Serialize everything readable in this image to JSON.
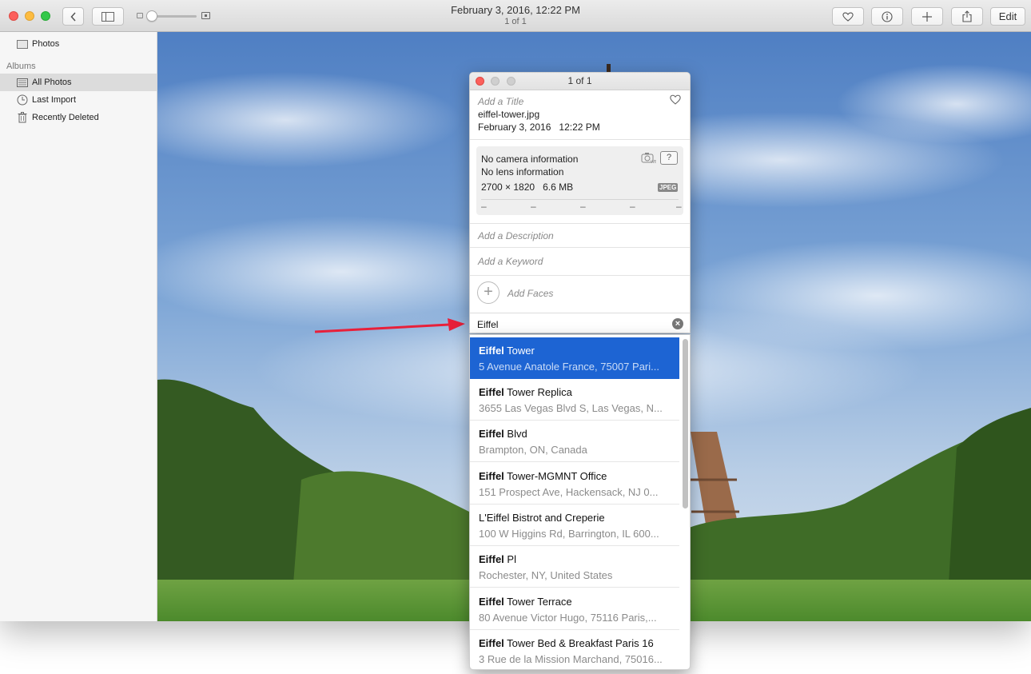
{
  "window": {
    "title": "February 3, 2016, 12:22 PM",
    "subtitle": "1 of 1"
  },
  "toolbar": {
    "back_icon": "chevron-left-icon",
    "sidebar_icon": "sidebar-icon",
    "favorite_icon": "heart-icon",
    "info_icon": "info-icon",
    "add_icon": "plus-icon",
    "share_icon": "share-icon",
    "edit_label": "Edit"
  },
  "sidebar": {
    "top_item": "Photos",
    "albums_header": "Albums",
    "items": [
      {
        "label": "All Photos",
        "icon": "photos-icon",
        "selected": true
      },
      {
        "label": "Last Import",
        "icon": "clock-icon",
        "selected": false
      },
      {
        "label": "Recently Deleted",
        "icon": "trash-icon",
        "selected": false
      }
    ]
  },
  "info_panel": {
    "title": "1 of 1",
    "title_placeholder": "Add a Title",
    "filename": "eiffel-tower.jpg",
    "date": "February 3, 2016",
    "time": "12:22 PM",
    "camera": "No camera information",
    "lens": "No lens information",
    "dimensions": "2700 × 1820",
    "size": "6.6 MB",
    "format": "JPEG",
    "exif_values": [
      "–",
      "–",
      "–",
      "–",
      "–"
    ],
    "description_placeholder": "Add a Description",
    "keyword_placeholder": "Add a Keyword",
    "faces_label": "Add Faces",
    "location_value": "Eiffel"
  },
  "suggestions": [
    {
      "bold": "Eiffel",
      "rest": " Tower",
      "address": "5 Avenue Anatole France, 75007 Pari...",
      "selected": true
    },
    {
      "bold": "Eiffel",
      "rest": " Tower Replica",
      "address": "3655 Las Vegas Blvd S, Las Vegas, N...",
      "selected": false
    },
    {
      "bold": "Eiffel",
      "rest": " Blvd",
      "address": "Brampton, ON, Canada",
      "selected": false
    },
    {
      "bold": "Eiffel",
      "rest": " Tower-MGMNT Office",
      "address": "151 Prospect Ave, Hackensack, NJ 0...",
      "selected": false
    },
    {
      "bold": "",
      "rest": "L'Eiffel Bistrot and Creperie",
      "address": "100 W Higgins Rd, Barrington, IL 600...",
      "selected": false
    },
    {
      "bold": "Eiffel",
      "rest": " Pl",
      "address": "Rochester, NY, United States",
      "selected": false
    },
    {
      "bold": "Eiffel",
      "rest": " Tower Terrace",
      "address": "80 Avenue Victor Hugo, 75116 Paris,...",
      "selected": false
    },
    {
      "bold": "Eiffel",
      "rest": " Tower Bed & Breakfast Paris 16",
      "address": "3 Rue de la Mission Marchand, 75016...",
      "selected": false
    }
  ],
  "colors": {
    "selection": "#1d64d3",
    "annotation_arrow": "#e8203a"
  }
}
